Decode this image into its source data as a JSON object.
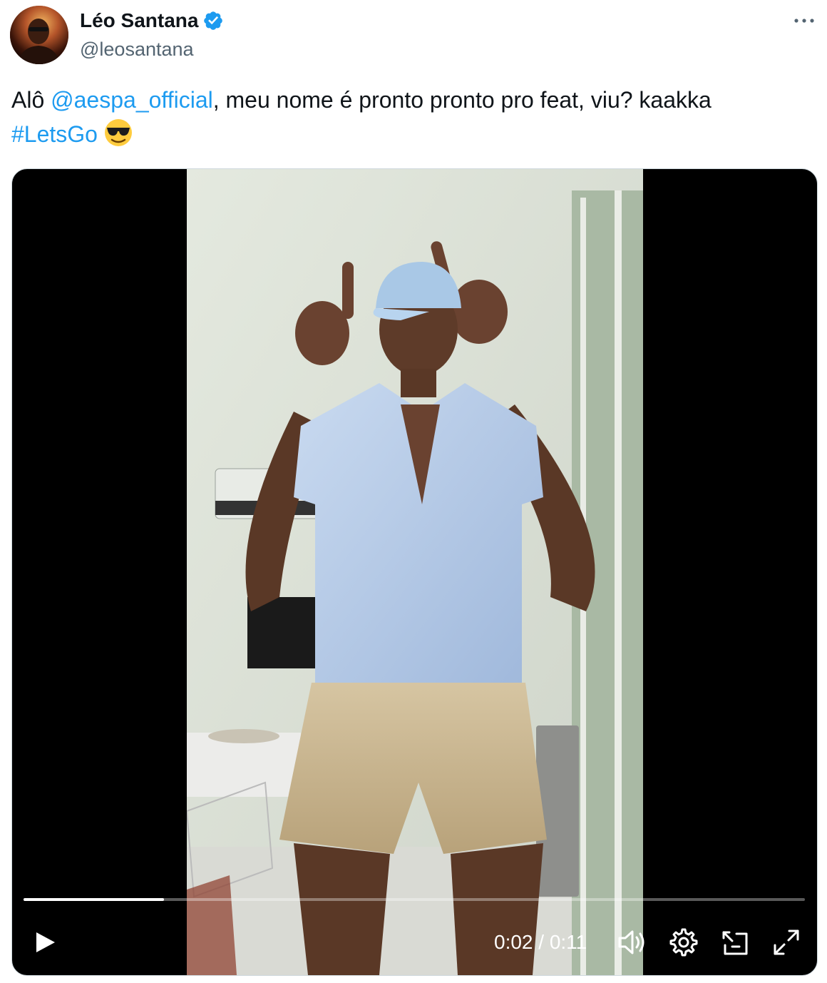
{
  "author": {
    "display_name": "Léo Santana",
    "handle": "@leosantana",
    "verified": true
  },
  "tweet": {
    "text_prefix": "Alô ",
    "mention": "@aespa_official",
    "text_middle": ", meu nome é pronto pronto pro feat, viu? kaakka",
    "hashtag": "#LetsGo",
    "emoji": "smiling-face-with-sunglasses"
  },
  "video": {
    "current_time": "0:02",
    "duration": "0:11",
    "time_display": "0:02 / 0:11",
    "progress": 0.18
  },
  "colors": {
    "link": "#1d9bf0",
    "verified": "#1d9bf0",
    "secondary_text": "#536471"
  }
}
